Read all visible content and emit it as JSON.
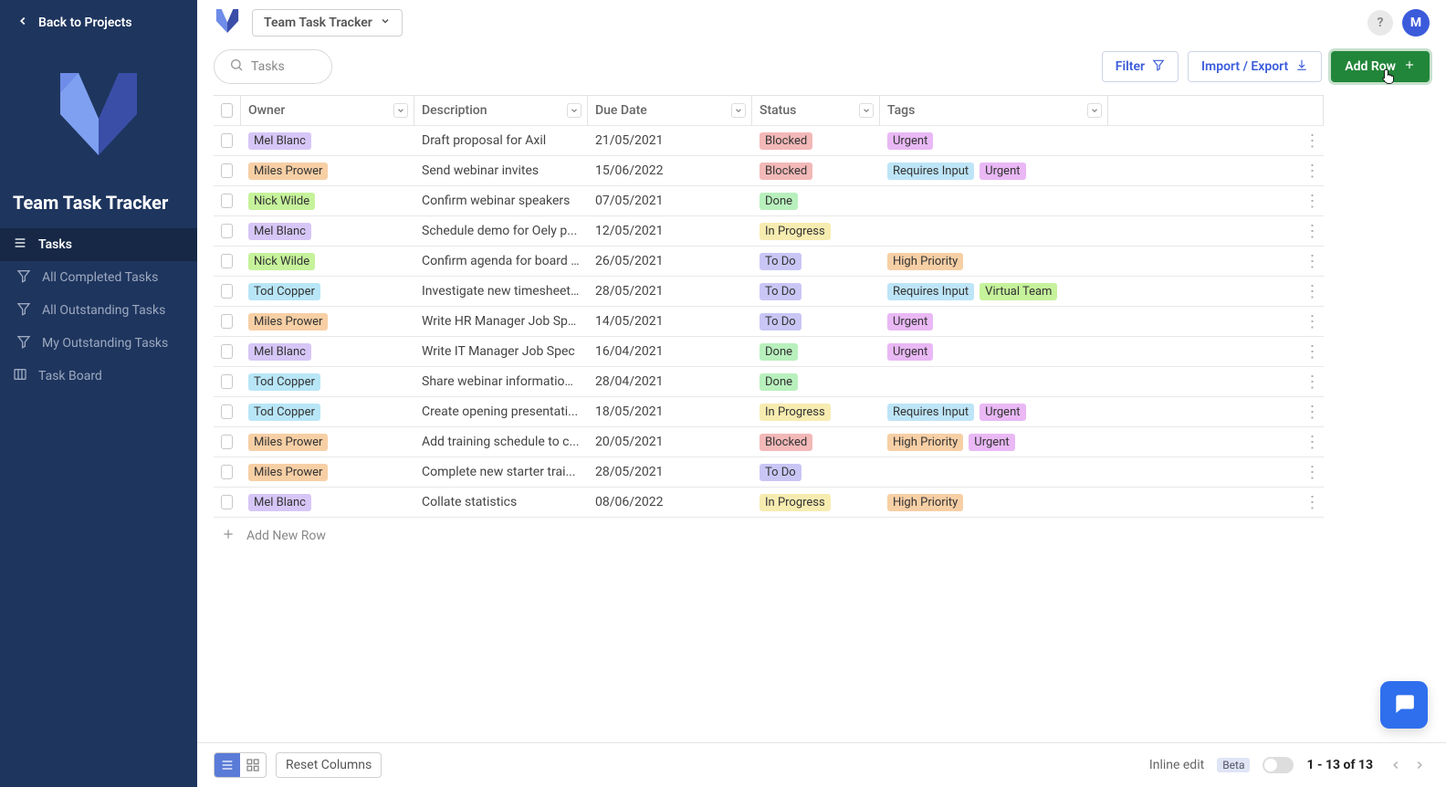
{
  "sidebar": {
    "back_label": "Back to Projects",
    "project_title": "Team Task Tracker",
    "nav": {
      "tasks": "Tasks",
      "completed": "All Completed Tasks",
      "outstanding": "All Outstanding Tasks",
      "my_outstanding": "My Outstanding Tasks",
      "board": "Task Board"
    }
  },
  "topbar": {
    "crumb_label": "Team Task Tracker",
    "avatar_initial": "M"
  },
  "toolbar": {
    "search_placeholder": "Tasks",
    "filter_label": "Filter",
    "import_export_label": "Import / Export",
    "add_row_label": "Add Row"
  },
  "columns": {
    "owner": "Owner",
    "description": "Description",
    "due": "Due Date",
    "status": "Status",
    "tags": "Tags"
  },
  "colors": {
    "owner": {
      "Mel Blanc": "#d6c6f7",
      "Miles Prower": "#f7cfa5",
      "Nick Wilde": "#c6f29b",
      "Tod Copper": "#b8e6f7"
    },
    "status": {
      "Blocked": "#f3b8b8",
      "Done": "#b8f0bd",
      "In Progress": "#f7ecb0",
      "To Do": "#c9c6f5"
    },
    "tag": {
      "Urgent": "#e9b8f5",
      "Requires Input": "#bde5f7",
      "High Priority": "#f7cfa5",
      "Virtual Team": "#c6f29b"
    }
  },
  "rows": [
    {
      "owner": "Mel Blanc",
      "description": "Draft proposal for Axil",
      "due": "21/05/2021",
      "status": "Blocked",
      "tags": [
        "Urgent"
      ]
    },
    {
      "owner": "Miles Prower",
      "description": "Send webinar invites",
      "due": "15/06/2022",
      "status": "Blocked",
      "tags": [
        "Requires Input",
        "Urgent"
      ]
    },
    {
      "owner": "Nick Wilde",
      "description": "Confirm webinar speakers",
      "due": "07/05/2021",
      "status": "Done",
      "tags": []
    },
    {
      "owner": "Mel Blanc",
      "description": "Schedule demo for Oely p...",
      "due": "12/05/2021",
      "status": "In Progress",
      "tags": []
    },
    {
      "owner": "Nick Wilde",
      "description": "Confirm agenda for board ...",
      "due": "26/05/2021",
      "status": "To Do",
      "tags": [
        "High Priority"
      ]
    },
    {
      "owner": "Tod Copper",
      "description": "Investigate new timesheet...",
      "due": "28/05/2021",
      "status": "To Do",
      "tags": [
        "Requires Input",
        "Virtual Team"
      ]
    },
    {
      "owner": "Miles Prower",
      "description": "Write HR Manager Job Spec",
      "due": "14/05/2021",
      "status": "To Do",
      "tags": [
        "Urgent"
      ]
    },
    {
      "owner": "Mel Blanc",
      "description": "Write IT Manager Job Spec",
      "due": "16/04/2021",
      "status": "Done",
      "tags": [
        "Urgent"
      ]
    },
    {
      "owner": "Tod Copper",
      "description": "Share webinar information...",
      "due": "28/04/2021",
      "status": "Done",
      "tags": []
    },
    {
      "owner": "Tod Copper",
      "description": "Create opening presentati...",
      "due": "18/05/2021",
      "status": "In Progress",
      "tags": [
        "Requires Input",
        "Urgent"
      ]
    },
    {
      "owner": "Miles Prower",
      "description": "Add training schedule to c...",
      "due": "20/05/2021",
      "status": "Blocked",
      "tags": [
        "High Priority",
        "Urgent"
      ]
    },
    {
      "owner": "Miles Prower",
      "description": "Complete new starter trai...",
      "due": "28/05/2021",
      "status": "To Do",
      "tags": []
    },
    {
      "owner": "Mel Blanc",
      "description": "Collate statistics",
      "due": "08/06/2022",
      "status": "In Progress",
      "tags": [
        "High Priority"
      ]
    }
  ],
  "table": {
    "add_new_row": "Add New Row"
  },
  "footer": {
    "reset_columns": "Reset Columns",
    "inline_edit": "Inline edit",
    "beta": "Beta",
    "pager": "1 - 13 of 13"
  }
}
